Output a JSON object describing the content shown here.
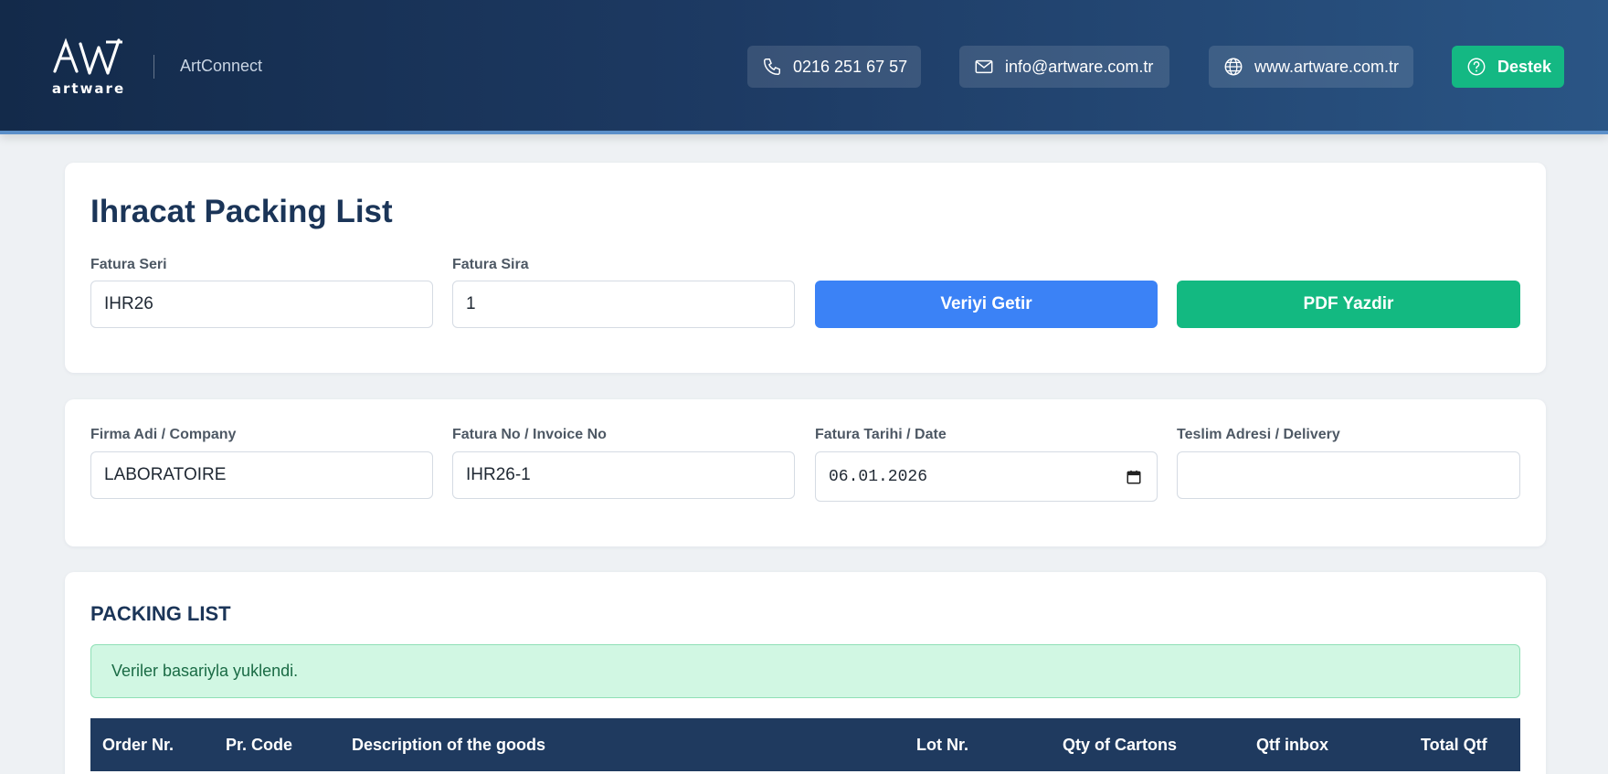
{
  "header": {
    "logo_text": "artware",
    "brand": "ArtConnect",
    "phone": "0216 251 67 57",
    "email": "info@artware.com.tr",
    "website": "www.artware.com.tr",
    "support_label": "Destek",
    "colors": {
      "accent": "#14b883",
      "header_start": "#132a4a",
      "header_end": "#2a5585"
    }
  },
  "search_card": {
    "title": "Ihracat Packing List",
    "fatura_seri": {
      "label": "Fatura Seri",
      "value": "IHR26"
    },
    "fatura_sira": {
      "label": "Fatura Sira",
      "value": "1"
    },
    "fetch_button": "Veriyi Getir",
    "pdf_button": "PDF Yazdir"
  },
  "info_card": {
    "company": {
      "label": "Firma Adi / Company",
      "value": "LABORATOIRE"
    },
    "invoice_no": {
      "label": "Fatura No / Invoice No",
      "value": "IHR26-1"
    },
    "invoice_date": {
      "label": "Fatura Tarihi / Date",
      "value": "06.01.2026"
    },
    "delivery": {
      "label": "Teslim Adresi / Delivery",
      "value": ""
    }
  },
  "packing_list": {
    "title": "PACKING LIST",
    "alert": "Veriler basariyla yuklendi.",
    "columns": [
      "Order Nr.",
      "Pr. Code",
      "Description of the goods",
      "Lot Nr.",
      "Qty of Cartons",
      "Qtf inbox",
      "Total Qtf"
    ]
  },
  "icons": {
    "phone": "phone-icon",
    "mail": "mail-icon",
    "web": "globe-icon",
    "support": "help-circle-icon",
    "calendar": "calendar-icon"
  }
}
